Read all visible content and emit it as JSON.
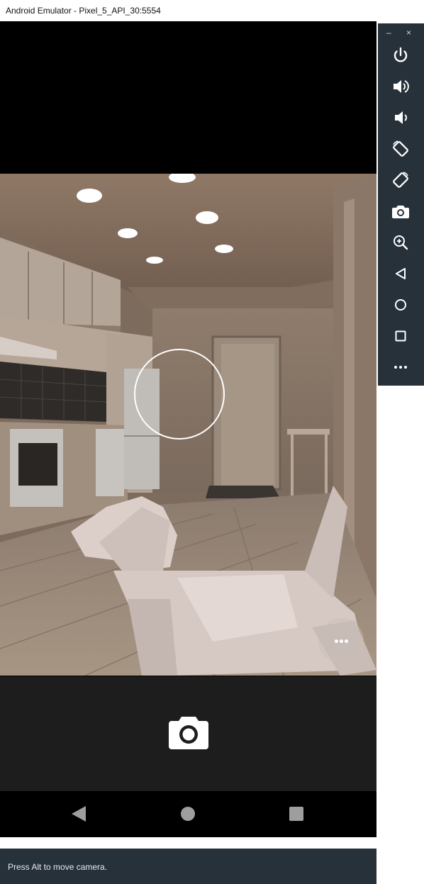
{
  "window": {
    "title": "Android Emulator - Pixel_5_API_30:5554",
    "minimize_label": "–",
    "close_label": "×"
  },
  "status": {
    "message": "Press Alt to move camera."
  },
  "toolbar": {
    "buttons": [
      {
        "name": "power-icon",
        "label": "Power"
      },
      {
        "name": "volume-up-icon",
        "label": "Volume up"
      },
      {
        "name": "volume-down-icon",
        "label": "Volume down"
      },
      {
        "name": "rotate-left-icon",
        "label": "Rotate left"
      },
      {
        "name": "rotate-right-icon",
        "label": "Rotate right"
      },
      {
        "name": "screenshot-icon",
        "label": "Take screenshot"
      },
      {
        "name": "zoom-icon",
        "label": "Zoom"
      },
      {
        "name": "back-icon",
        "label": "Back"
      },
      {
        "name": "home-icon",
        "label": "Home"
      },
      {
        "name": "overview-icon",
        "label": "Overview"
      },
      {
        "name": "more-icon",
        "label": "Extended controls"
      }
    ]
  },
  "colors": {
    "toolbar_bg": "#27313a",
    "camera_panel_bg": "#1d1d1d",
    "statusbar_bg": "#27313a"
  }
}
